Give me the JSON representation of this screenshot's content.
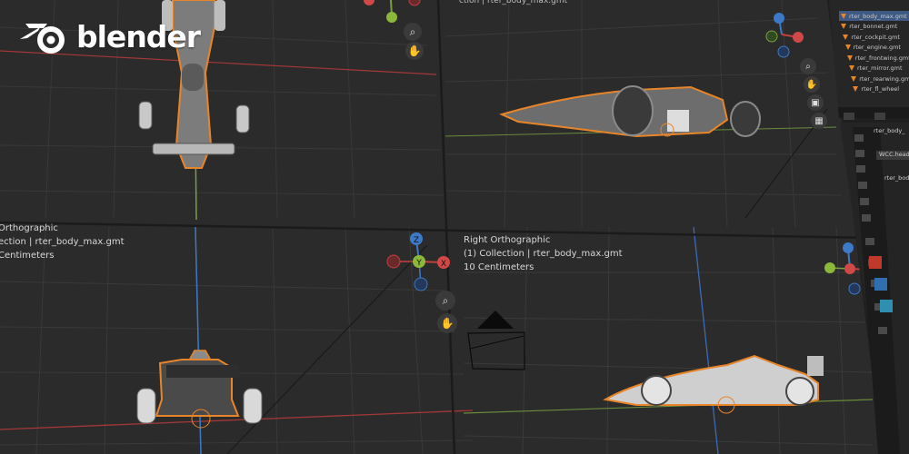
{
  "logo": {
    "text": "blender",
    "icon": "blender-logo-icon"
  },
  "viewports": {
    "top_left": {
      "button_icons": [
        "zoom-icon",
        "hand-icon"
      ]
    },
    "top_right": {
      "header_text": "ction | rter_body_max.gmt",
      "button_icons": [
        "zoom-icon",
        "hand-icon",
        "camera-icon",
        "grid-icon"
      ]
    },
    "bottom_left": {
      "view_name": "Orthographic",
      "collection": "ection | rter_body_max.gmt",
      "units": "Centimeters"
    },
    "bottom_center": {
      "view_name": "Right Orthographic",
      "collection": "(1) Collection | rter_body_max.gmt",
      "units": "10 Centimeters",
      "button_icons": [
        "zoom-icon",
        "hand-icon"
      ]
    },
    "bottom_right": {
      "button_icons": [
        "zoom-icon",
        "hand-icon"
      ]
    }
  },
  "gizmo_labels": {
    "x": "X",
    "y": "Y",
    "z": "Z"
  },
  "outliner": {
    "items": [
      "rter_body_max.gmt",
      "rter_bonnet.gmt",
      "rter_cockpit.gmt",
      "rter_engine.gmt",
      "rter_frontwing.gmt",
      "rter_mirror.gmt",
      "rter_rearwing.gmt",
      "rter_fl_wheel"
    ]
  },
  "properties": {
    "items": [
      "rter_body_",
      "WCC.head",
      "rter_bod"
    ]
  },
  "colors": {
    "background": "#2b2b2b",
    "grid": "#363636",
    "x_axis": "#b03a3a",
    "y_axis": "#7aa040",
    "z_axis": "#3c7ac8",
    "selection": "#e8852a",
    "ui_panel": "#1f1f1f"
  }
}
